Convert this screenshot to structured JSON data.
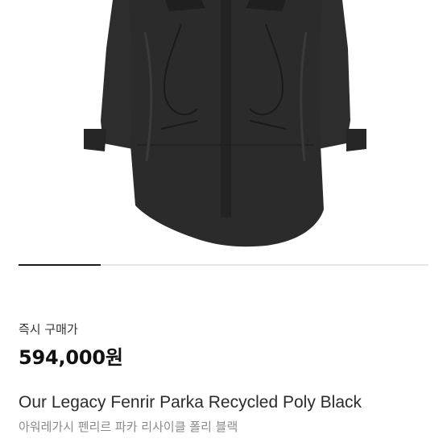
{
  "product": {
    "image_alt": "black parka",
    "price_label": "즉시 구매가",
    "price": "594,000원",
    "title_en": "Our Legacy Fenrir Parka Recycled Poly Black",
    "title_ko": "아워레가시 펜리르 파카 리사이클 폴리 블랙"
  },
  "gallery": {
    "progress": 0.2
  },
  "colors": {
    "jacket": "#2b2b2b",
    "jacket_dark": "#1d1d1d",
    "accent_text": "#111111",
    "muted_text": "#8a8a8a"
  }
}
